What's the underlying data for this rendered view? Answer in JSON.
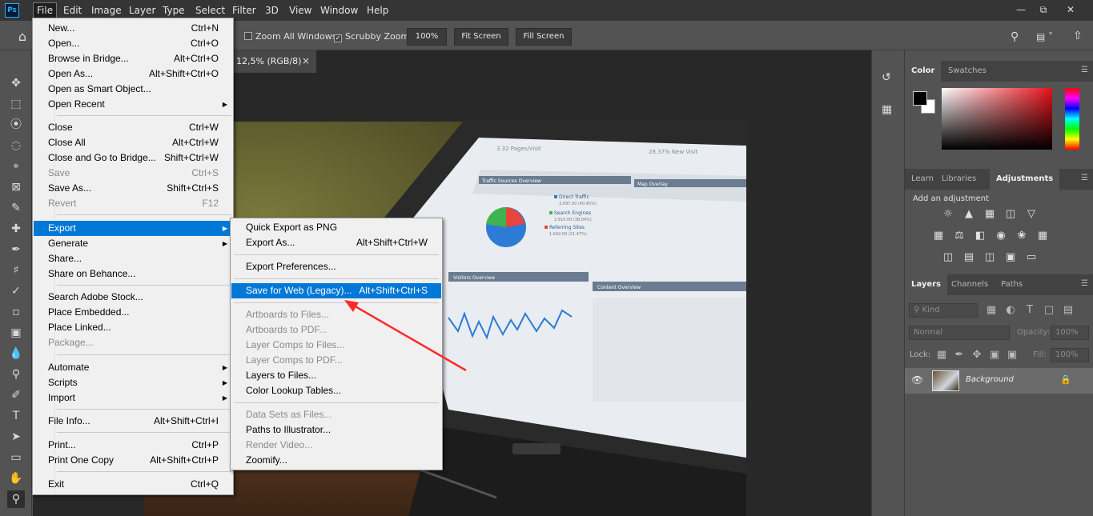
{
  "app": {
    "logo": "Ps"
  },
  "menubar": {
    "items": [
      "File",
      "Edit",
      "Image",
      "Layer",
      "Type",
      "Select",
      "Filter",
      "3D",
      "View",
      "Window",
      "Help"
    ]
  },
  "options": {
    "zoom_all_windows": "Zoom All Windows",
    "scrubby_zoom": "Scrubby Zoom",
    "zoom_value": "100%",
    "fit_screen": "Fit Screen",
    "fill_screen": "Fill Screen"
  },
  "document": {
    "tab_title": "12,5% (RGB/8)",
    "close": "×"
  },
  "file_menu": {
    "items": [
      {
        "label": "New...",
        "shortcut": "Ctrl+N"
      },
      {
        "label": "Open...",
        "shortcut": "Ctrl+O"
      },
      {
        "label": "Browse in Bridge...",
        "shortcut": "Alt+Ctrl+O"
      },
      {
        "label": "Open As...",
        "shortcut": "Alt+Shift+Ctrl+O"
      },
      {
        "label": "Open as Smart Object...",
        "shortcut": ""
      },
      {
        "label": "Open Recent",
        "shortcut": ""
      },
      {
        "label": "Close",
        "shortcut": "Ctrl+W"
      },
      {
        "label": "Close All",
        "shortcut": "Alt+Ctrl+W"
      },
      {
        "label": "Close and Go to Bridge...",
        "shortcut": "Shift+Ctrl+W"
      },
      {
        "label": "Save",
        "shortcut": "Ctrl+S"
      },
      {
        "label": "Save As...",
        "shortcut": "Shift+Ctrl+S"
      },
      {
        "label": "Revert",
        "shortcut": "F12"
      },
      {
        "label": "Export",
        "shortcut": ""
      },
      {
        "label": "Generate",
        "shortcut": ""
      },
      {
        "label": "Share...",
        "shortcut": ""
      },
      {
        "label": "Share on Behance...",
        "shortcut": ""
      },
      {
        "label": "Search Adobe Stock...",
        "shortcut": ""
      },
      {
        "label": "Place Embedded...",
        "shortcut": ""
      },
      {
        "label": "Place Linked...",
        "shortcut": ""
      },
      {
        "label": "Package...",
        "shortcut": ""
      },
      {
        "label": "Automate",
        "shortcut": ""
      },
      {
        "label": "Scripts",
        "shortcut": ""
      },
      {
        "label": "Import",
        "shortcut": ""
      },
      {
        "label": "File Info...",
        "shortcut": "Alt+Shift+Ctrl+I"
      },
      {
        "label": "Print...",
        "shortcut": "Ctrl+P"
      },
      {
        "label": "Print One Copy",
        "shortcut": "Alt+Shift+Ctrl+P"
      },
      {
        "label": "Exit",
        "shortcut": "Ctrl+Q"
      }
    ]
  },
  "export_menu": {
    "items": [
      {
        "label": "Quick Export as PNG",
        "shortcut": ""
      },
      {
        "label": "Export As...",
        "shortcut": "Alt+Shift+Ctrl+W"
      },
      {
        "label": "Export Preferences...",
        "shortcut": ""
      },
      {
        "label": "Save for Web (Legacy)...",
        "shortcut": "Alt+Shift+Ctrl+S"
      },
      {
        "label": "Artboards to Files...",
        "shortcut": ""
      },
      {
        "label": "Artboards to PDF...",
        "shortcut": ""
      },
      {
        "label": "Layer Comps to Files...",
        "shortcut": ""
      },
      {
        "label": "Layer Comps to PDF...",
        "shortcut": ""
      },
      {
        "label": "Layers to Files...",
        "shortcut": ""
      },
      {
        "label": "Color Lookup Tables...",
        "shortcut": ""
      },
      {
        "label": "Data Sets as Files...",
        "shortcut": ""
      },
      {
        "label": "Paths to Illustrator...",
        "shortcut": ""
      },
      {
        "label": "Render Video...",
        "shortcut": ""
      },
      {
        "label": "Zoomify...",
        "shortcut": ""
      }
    ]
  },
  "color_panel": {
    "tabs": [
      "Color",
      "Swatches"
    ]
  },
  "adjust_panel": {
    "tabs": [
      "Learn",
      "Libraries",
      "Adjustments"
    ],
    "hint": "Add an adjustment"
  },
  "layers_panel": {
    "tabs": [
      "Layers",
      "Channels",
      "Paths"
    ],
    "kind": "Kind",
    "blend_mode": "Normal",
    "opacity_label": "Opacity:",
    "opacity_value": "100%",
    "lock_label": "Lock:",
    "fill_label": "Fill:",
    "fill_value": "100%",
    "layer_name": "Background"
  },
  "screen_text": {
    "pages_visit": "3.32 Pages/Visit",
    "pct": "28.37% New Visit",
    "traffic_title": "Traffic Sources Overview",
    "map_title": "Map Overlay",
    "legend": [
      "Direct Traffic",
      "Search Engines",
      "Referring Sites"
    ],
    "legend_vals": [
      "3,097.00 (40.45%)",
      "2,910.00 (38.04%)",
      "1,642.00 (21.47%)"
    ],
    "visitors_title": "Visitors Overview",
    "content_title": "Content Overview"
  },
  "colors": {
    "accent": "#0078d7",
    "arrow": "#ff2a2a"
  }
}
